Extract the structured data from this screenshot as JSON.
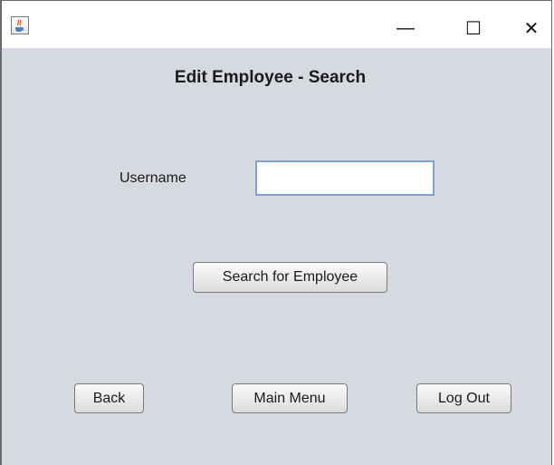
{
  "window": {
    "icon": "java-cup-icon",
    "controls": {
      "minimize": "—",
      "maximize": "☐",
      "close": "✕"
    }
  },
  "form": {
    "title": "Edit Employee - Search",
    "username_label": "Username",
    "username_value": "",
    "search_button": "Search for Employee"
  },
  "footer": {
    "back_button": "Back",
    "main_menu_button": "Main Menu",
    "logout_button": "Log Out"
  }
}
